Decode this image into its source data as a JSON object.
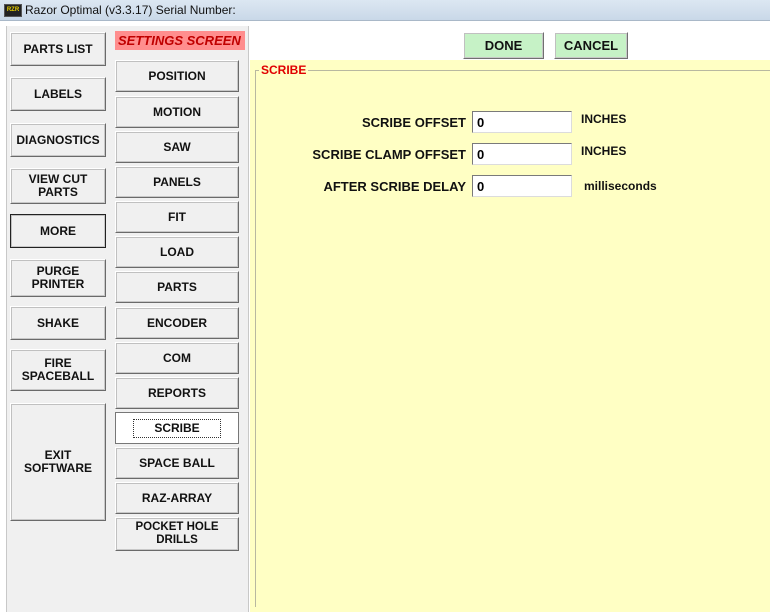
{
  "window": {
    "icon_text": "RAZOR",
    "title": "Razor Optimal (v3.3.17)  Serial Number:"
  },
  "left_nav": {
    "items": [
      {
        "label": "PARTS LIST"
      },
      {
        "label": "LABELS"
      },
      {
        "label": "DIAGNOSTICS"
      },
      {
        "label": "VIEW CUT\nPARTS"
      },
      {
        "label": "MORE"
      },
      {
        "label": "PURGE\nPRINTER"
      },
      {
        "label": "SHAKE"
      },
      {
        "label": "FIRE\nSPACEBALL"
      },
      {
        "label": "EXIT\nSOFTWARE"
      }
    ]
  },
  "settings": {
    "title": "SETTINGS SCREEN",
    "tabs": [
      {
        "label": "POSITION"
      },
      {
        "label": "MOTION"
      },
      {
        "label": "SAW"
      },
      {
        "label": "PANELS"
      },
      {
        "label": "FIT"
      },
      {
        "label": "LOAD"
      },
      {
        "label": "PARTS"
      },
      {
        "label": "ENCODER"
      },
      {
        "label": "COM"
      },
      {
        "label": "REPORTS"
      },
      {
        "label": "SCRIBE",
        "selected": true
      },
      {
        "label": "SPACE BALL"
      },
      {
        "label": "RAZ-ARRAY"
      },
      {
        "label": "POCKET HOLE DRILLS"
      }
    ]
  },
  "toolbar": {
    "done_label": "DONE",
    "cancel_label": "CANCEL"
  },
  "scribe": {
    "group_label": "SCRIBE",
    "rows": [
      {
        "label": "SCRIBE OFFSET",
        "value": "0",
        "unit": "INCHES"
      },
      {
        "label": "SCRIBE CLAMP OFFSET",
        "value": "0",
        "unit": "INCHES"
      },
      {
        "label": "AFTER SCRIBE DELAY",
        "value": "0",
        "unit": "milliseconds"
      }
    ]
  },
  "colors": {
    "panel_background": "#ffffc4",
    "settings_title_bg": "#ff8e8e",
    "settings_title_text": "#c00000",
    "group_label_text": "#e00000",
    "ok_buttons": "#c6f2c6"
  }
}
